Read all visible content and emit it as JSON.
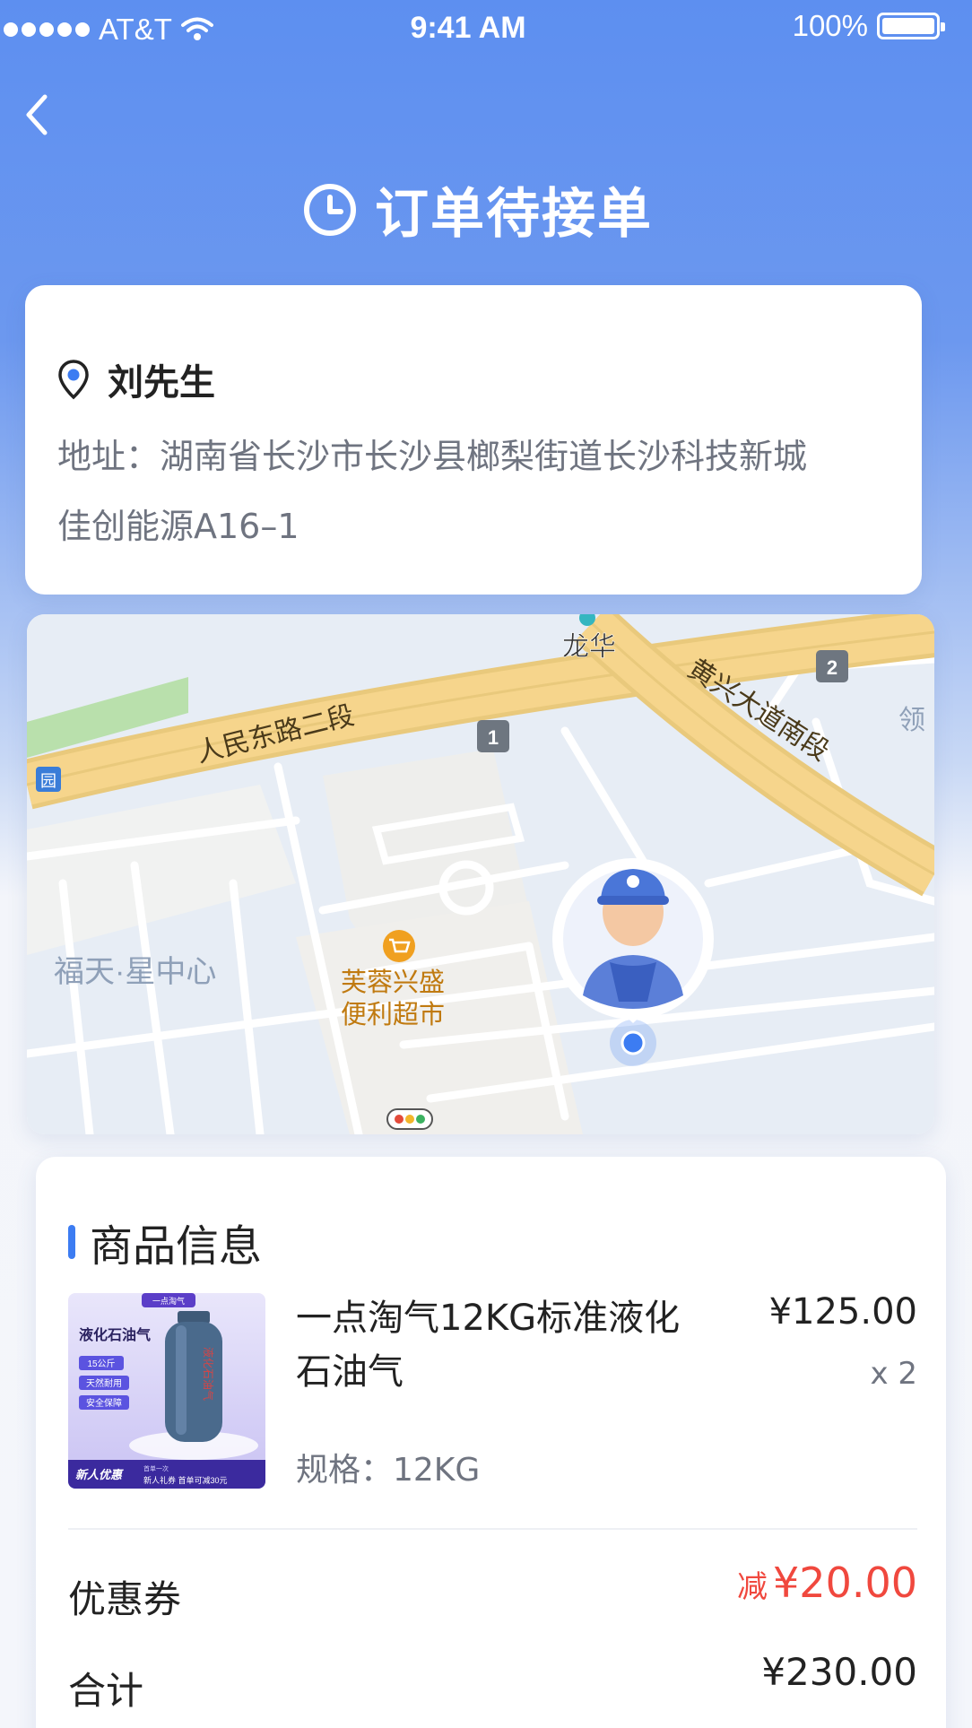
{
  "status_bar": {
    "carrier": "AT&T",
    "time": "9:41 AM",
    "battery": "100%"
  },
  "header": {
    "title": "订单待接单"
  },
  "address_card": {
    "contact_name": "刘先生",
    "address_line1": "地址：湖南省长沙市长沙县榔梨街道长沙科技新城",
    "address_line2": "佳创能源A16–1"
  },
  "map": {
    "labels": {
      "road_1": "人民东路二段",
      "road_2": "黄兴大道南段",
      "place_longhua": "龙华",
      "place_fortune": "福天·星中心",
      "store_line1": "芙蓉兴盛",
      "store_line2": "便利超市",
      "partial_ling": "领",
      "badge_1": "1",
      "badge_2": "2",
      "bus_icon_text": "园"
    }
  },
  "goods": {
    "section_title": "商品信息",
    "product": {
      "name": "一点淘气12KG标准液化石油气",
      "price": "¥125.00",
      "quantity": "x 2",
      "spec": "规格：12KG",
      "image_texts": {
        "brand": "一点淘气",
        "heading": "液化石油气",
        "tag1": "15公斤",
        "tag2": "天然耐用",
        "tag3": "安全保障",
        "promo": "新人优惠",
        "promo_sub1": "首单一次",
        "promo_sub2": "新人礼券 首单可减30元",
        "tank_text": "液化石油气"
      }
    },
    "coupon_label": "优惠券",
    "coupon_prefix": "减",
    "coupon_amount": "¥20.00",
    "total_label": "合计",
    "total_amount": "¥230.00"
  },
  "colors": {
    "header_blue": "#5d8ff0",
    "accent_blue": "#3c7cf2",
    "discount_red": "#f0483e",
    "road_yellow": "#f6d58c",
    "map_water": "#e7edf5"
  }
}
